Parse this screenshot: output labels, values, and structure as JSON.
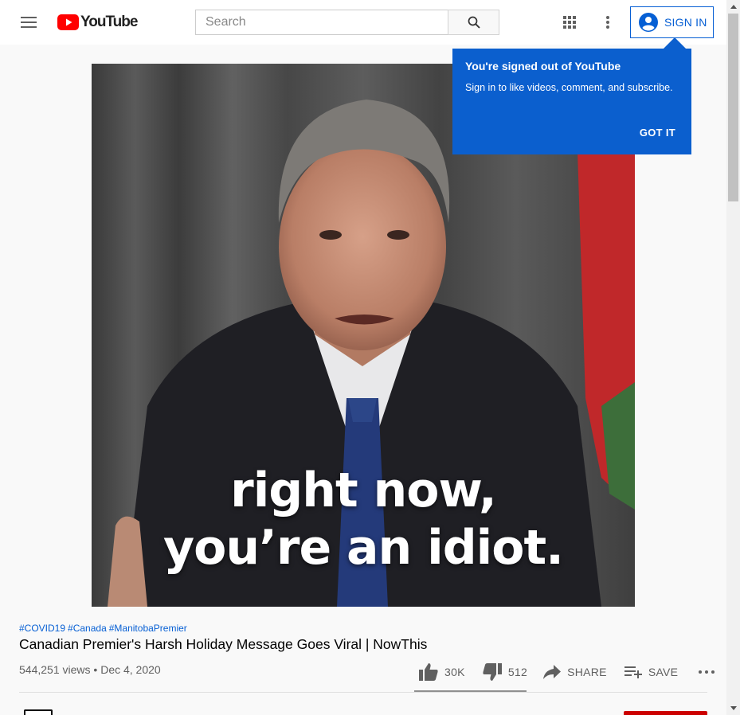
{
  "header": {
    "logo_text": "YouTube",
    "search_placeholder": "Search",
    "signin_label": "SIGN IN"
  },
  "tooltip": {
    "title": "You're signed out of YouTube",
    "body": "Sign in to like videos, comment, and subscribe.",
    "button": "GOT IT"
  },
  "video": {
    "caption_line1": "right now,",
    "caption_line2": "you’re an idiot.",
    "hashtags": [
      "#COVID19",
      "#Canada",
      "#ManitobaPremier"
    ],
    "title": "Canadian Premier's Harsh Holiday Message Goes Viral | NowThis",
    "views": "544,251 views",
    "date": "Dec 4, 2020",
    "separator": "•"
  },
  "actions": {
    "likes": "30K",
    "dislikes": "512",
    "share": "SHARE",
    "save": "SAVE"
  },
  "colors": {
    "brand_red": "#ff0000",
    "link_blue": "#065fd4",
    "tooltip_blue": "#0b5fce"
  }
}
